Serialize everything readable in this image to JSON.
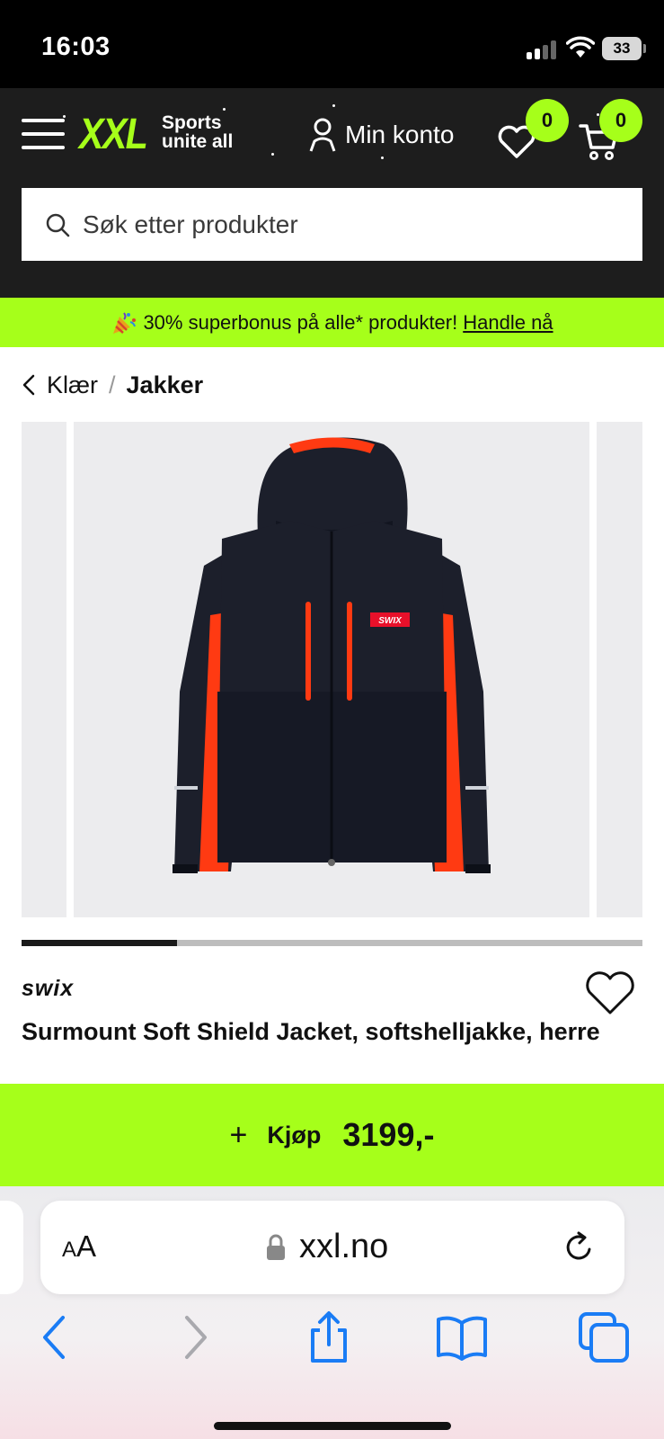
{
  "status_bar": {
    "time": "16:03",
    "battery": "33"
  },
  "header": {
    "logo_text": "XXL",
    "logo_tagline_1": "Sports",
    "logo_tagline_2": "unite all",
    "account_label": "Min konto",
    "wishlist_count": "0",
    "cart_count": "0",
    "search_placeholder": "Søk etter produkter"
  },
  "promo": {
    "text": "30% superbonus på alle* produkter!",
    "link": "Handle nå"
  },
  "breadcrumb": {
    "parent": "Klær",
    "separator": "/",
    "current": "Jakker"
  },
  "gallery": {
    "current_index": 1,
    "total": 4,
    "progress_fraction": 0.25
  },
  "product": {
    "brand": "swix",
    "title": "Surmount Soft Shield Jacket, softshelljakke, herre",
    "chest_logo": "SWIX"
  },
  "buy_bar": {
    "plus": "+",
    "label": "Kjøp",
    "price": "3199,-"
  },
  "browser": {
    "text_size_small": "A",
    "text_size_large": "A",
    "url": "xxl.no"
  },
  "colors": {
    "accent": "#a6ff1a",
    "header_bg": "#1d1d1d",
    "jacket_body": "#1c1f2b",
    "jacket_accent": "#ff3a12",
    "safari_blue": "#1a7cf5"
  },
  "icons": {
    "menu": "hamburger-icon",
    "account": "person-icon",
    "wishlist": "heart-icon",
    "cart": "cart-icon",
    "search": "search-icon",
    "breadcrumb_back": "chevron-left-icon",
    "favorite": "heart-outline-icon",
    "lock": "lock-icon",
    "reload": "reload-icon",
    "back": "back-arrow-icon",
    "forward": "forward-arrow-icon",
    "share": "share-icon",
    "bookmarks": "book-icon",
    "tabs": "tabs-icon"
  }
}
